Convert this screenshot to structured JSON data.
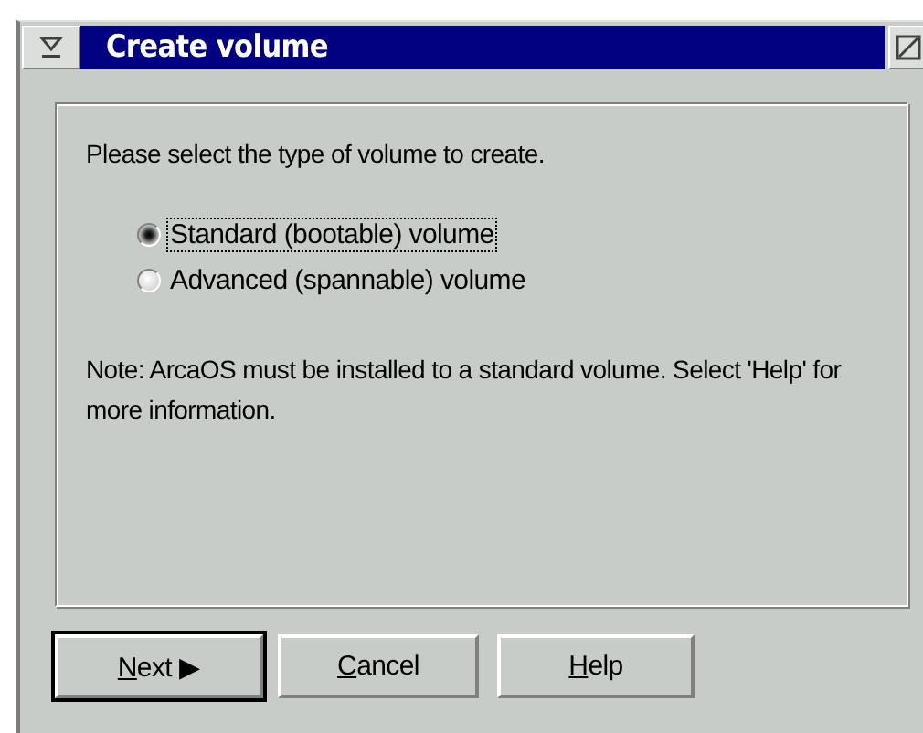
{
  "window": {
    "title": "Create volume"
  },
  "prompt": "Please select the type of volume to create.",
  "options": [
    {
      "label": "Standard (bootable) volume",
      "selected": true,
      "focused": true
    },
    {
      "label": "Advanced (spannable) volume",
      "selected": false,
      "focused": false
    }
  ],
  "note": "Note:  ArcaOS must be installed to a standard volume.  Select 'Help' for more information.",
  "buttons": [
    {
      "label": "Next ▶",
      "default": true,
      "underline_first": true
    },
    {
      "label": "Cancel",
      "default": false,
      "underline_first": true
    },
    {
      "label": "Help",
      "default": false,
      "underline_first": true
    }
  ]
}
